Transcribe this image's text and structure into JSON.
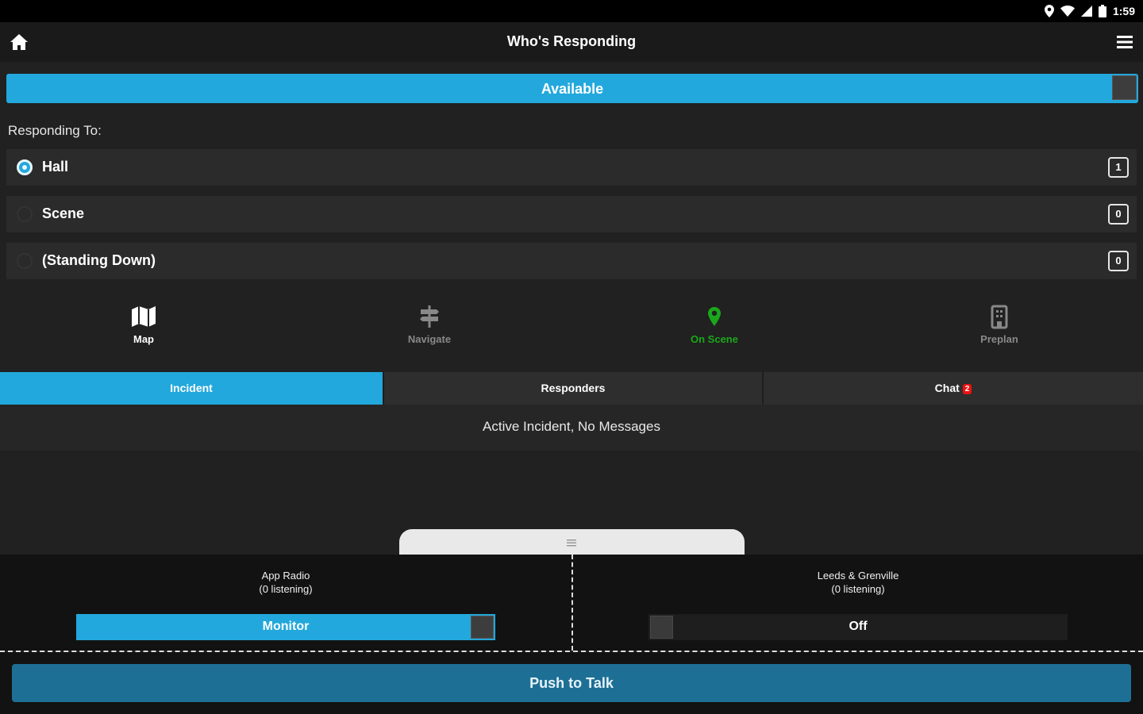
{
  "status_bar": {
    "time": "1:59",
    "icons": [
      "location-icon",
      "wifi-icon",
      "signal-icon",
      "battery-icon"
    ]
  },
  "header": {
    "title": "Who's Responding",
    "left_icon": "home-icon",
    "right_icon": "menu-icon"
  },
  "availability": {
    "label": "Available",
    "state": "on",
    "color": "#22a8dc"
  },
  "responding": {
    "label": "Responding To:",
    "options": [
      {
        "name": "Hall",
        "count": "1",
        "selected": true
      },
      {
        "name": "Scene",
        "count": "0",
        "selected": false
      },
      {
        "name": "(Standing Down)",
        "count": "0",
        "selected": false
      }
    ]
  },
  "actions": [
    {
      "label": "Map",
      "icon": "map-icon",
      "color": "#ffffff"
    },
    {
      "label": "Navigate",
      "icon": "signpost-icon",
      "color": "#888888"
    },
    {
      "label": "On Scene",
      "icon": "map-pin-icon",
      "color": "#1aa81a"
    },
    {
      "label": "Preplan",
      "icon": "building-icon",
      "color": "#888888"
    }
  ],
  "tabs": [
    {
      "label": "Incident",
      "active": true
    },
    {
      "label": "Responders",
      "active": false
    },
    {
      "label": "Chat",
      "active": false,
      "badge": "2"
    }
  ],
  "incident": {
    "message": "Active Incident, No Messages"
  },
  "radio": {
    "channels": [
      {
        "name": "App Radio",
        "listeners": "(0 listening)",
        "toggle_label": "Monitor",
        "state": "on"
      },
      {
        "name": "Leeds & Grenville",
        "listeners": "(0 listening)",
        "toggle_label": "Off",
        "state": "off"
      }
    ],
    "push_to_talk": "Push to Talk"
  },
  "colors": {
    "accent": "#22a8dc",
    "background": "#212121",
    "ptt": "#1e6f95",
    "on_scene": "#1aa81a",
    "badge": "#ee1111"
  }
}
